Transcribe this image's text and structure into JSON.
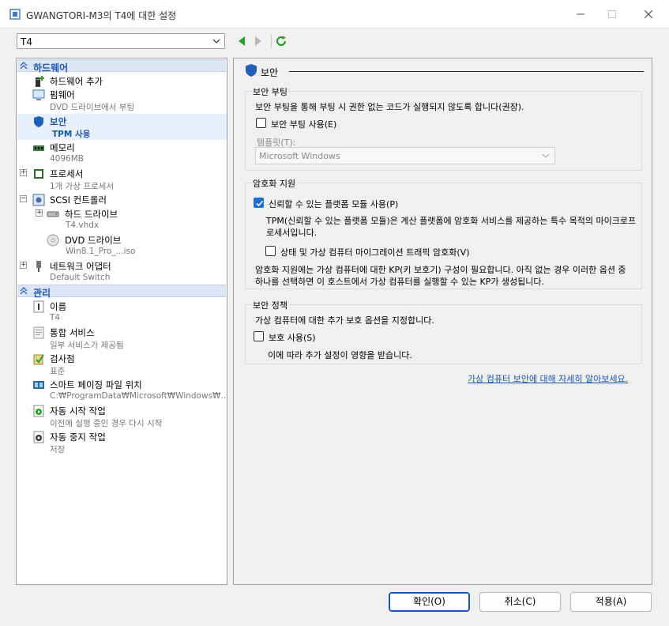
{
  "window": {
    "title": "GWANGTORI-M3의 T4에 대한 설정"
  },
  "toolbar": {
    "vm_name": "T4"
  },
  "tree": {
    "hardware_header": "하드웨어",
    "management_header": "관리",
    "hardware": [
      {
        "label": "하드웨어 추가",
        "sub": ""
      },
      {
        "label": "펌웨어",
        "sub": "DVD 드라이브에서 부팅"
      },
      {
        "label": "보안",
        "sub": "TPM 사용"
      },
      {
        "label": "메모리",
        "sub": "4096MB"
      },
      {
        "label": "프로세서",
        "sub": "1개 가상 프로세서"
      },
      {
        "label": "SCSI 컨트롤러",
        "sub": ""
      },
      {
        "label": "하드 드라이브",
        "sub": "T4.vhdx"
      },
      {
        "label": "DVD 드라이브",
        "sub": "Win8.1_Pro_...iso"
      },
      {
        "label": "네트워크 어댑터",
        "sub": "Default Switch"
      }
    ],
    "management": [
      {
        "label": "이름",
        "sub": "T4"
      },
      {
        "label": "통합 서비스",
        "sub": "일부 서비스가 제공됨"
      },
      {
        "label": "검사점",
        "sub": "표준"
      },
      {
        "label": "스마트 페이징 파일 위치",
        "sub": "C:₩ProgramData₩Microsoft₩Windows₩..."
      },
      {
        "label": "자동 시작 작업",
        "sub": "이전에 실행 중인 경우 다시 시작"
      },
      {
        "label": "자동 중지 작업",
        "sub": "저장"
      }
    ]
  },
  "panel": {
    "title": "보안",
    "secure_boot": {
      "group_label": "보안 부팅",
      "desc": "보안 부팅을 통해 부팅 시 권한 없는 코드가 실행되지 않도록 합니다(권장).",
      "checkbox_label": "보안 부팅 사용(E)",
      "checked": false,
      "template_label": "템플릿(T):",
      "template_value": "Microsoft Windows"
    },
    "encryption": {
      "group_label": "암호화 지원",
      "tpm_label": "신뢰할 수 있는 플랫폼 모듈 사용(P)",
      "tpm_checked": true,
      "tpm_desc": "TPM(신뢰할 수 있는 플랫폼 모듈)은 계산 플랫폼에 암호화 서비스를 제공하는 특수 목적의 마이크로프로세서입니다.",
      "migration_label": "상태 및 가상 컴퓨터 마이그레이션 트래픽 암호화(V)",
      "migration_checked": false,
      "kp_desc": "암호화 지원에는 가상 컴퓨터에 대한 KP(키 보호기) 구성이 필요합니다. 아직 없는 경우 이러한 옵션 중 하나를 선택하면 이 호스트에서 가상 컴퓨터를 실행할 수 있는 KP가 생성됩니다."
    },
    "policy": {
      "group_label": "보안 정책",
      "desc": "가상 컴퓨터에 대한 추가 보호 옵션을 지정합니다.",
      "checkbox_label": "보호 사용(S)",
      "checked": false,
      "note": "이에 따라 추가 설정이 영향을 받습니다."
    },
    "learn_more": "가상 컴퓨터 보안에 대해 자세히 알아보세요."
  },
  "buttons": {
    "ok": "확인(O)",
    "cancel": "취소(C)",
    "apply": "적용(A)"
  },
  "colors": {
    "accent": "#1a56b4",
    "checkbox": "#1a6fd0",
    "nav_green": "#2aa02a"
  }
}
